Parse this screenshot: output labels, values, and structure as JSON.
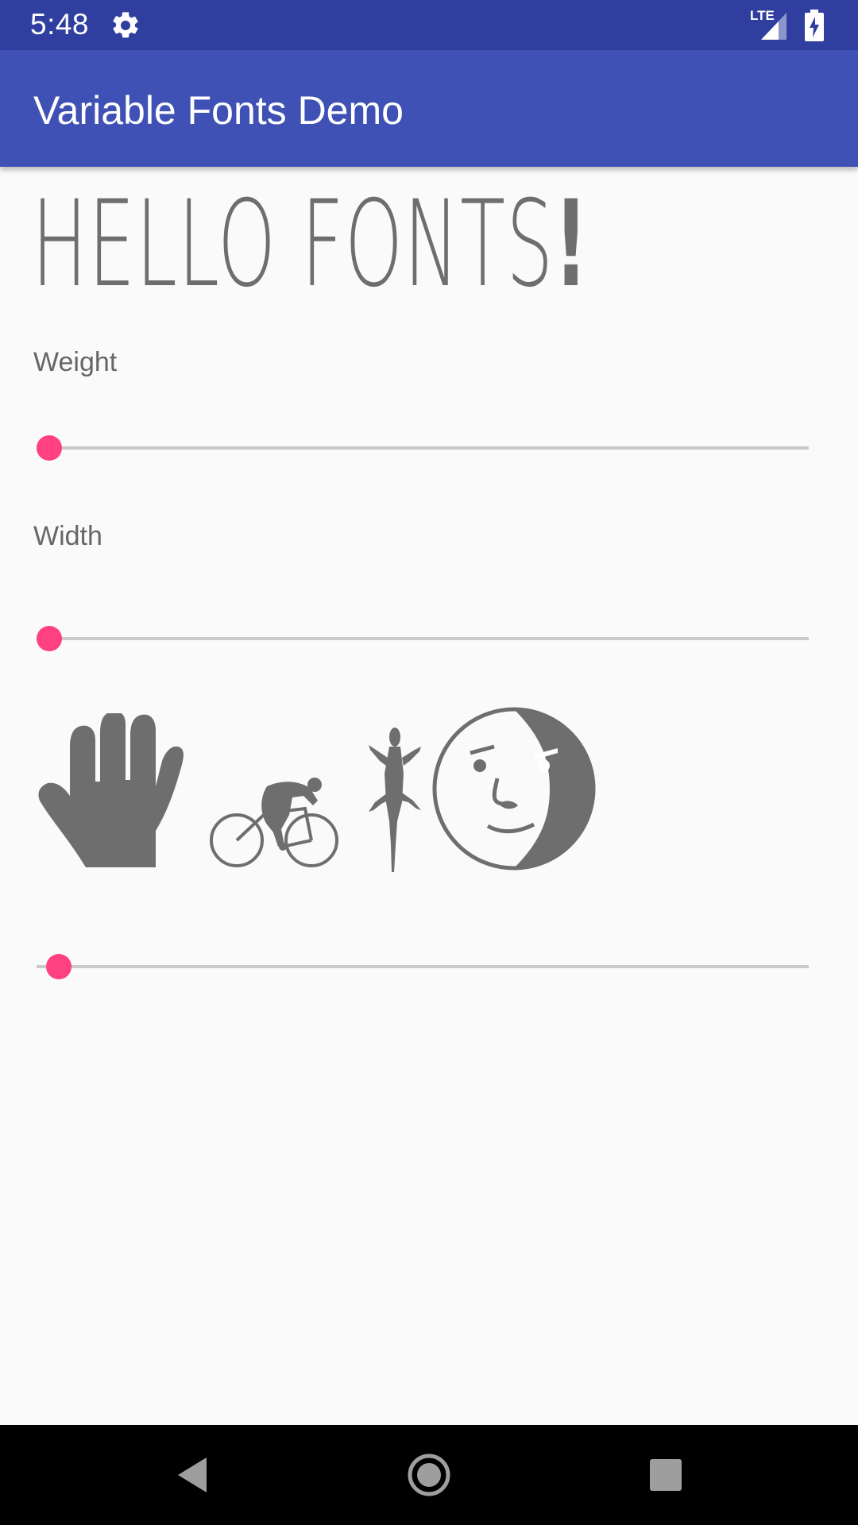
{
  "status_bar": {
    "time": "5:48",
    "network": "LTE",
    "icons": [
      "gear-icon",
      "lte-signal-icon",
      "battery-charging-icon"
    ]
  },
  "app_bar": {
    "title": "Variable Fonts Demo"
  },
  "preview": {
    "text": "HELLO FONTS",
    "emphasis": "!"
  },
  "controls": {
    "weight_label": "Weight",
    "weight_value": 0,
    "width_label": "Width",
    "width_value": 0,
    "glyph_slider_value": 0
  },
  "glyphs": [
    "hand-icon",
    "cyclist-icon",
    "lizard-icon",
    "moon-face-icon"
  ],
  "colors": {
    "status_bar": "#303f9f",
    "app_bar": "#3f51b5",
    "accent": "#ff4081",
    "text_gray": "#6e6e6e",
    "background": "#fafafa"
  },
  "nav_bar": {
    "buttons": [
      "back-icon",
      "home-icon",
      "recents-icon"
    ]
  }
}
